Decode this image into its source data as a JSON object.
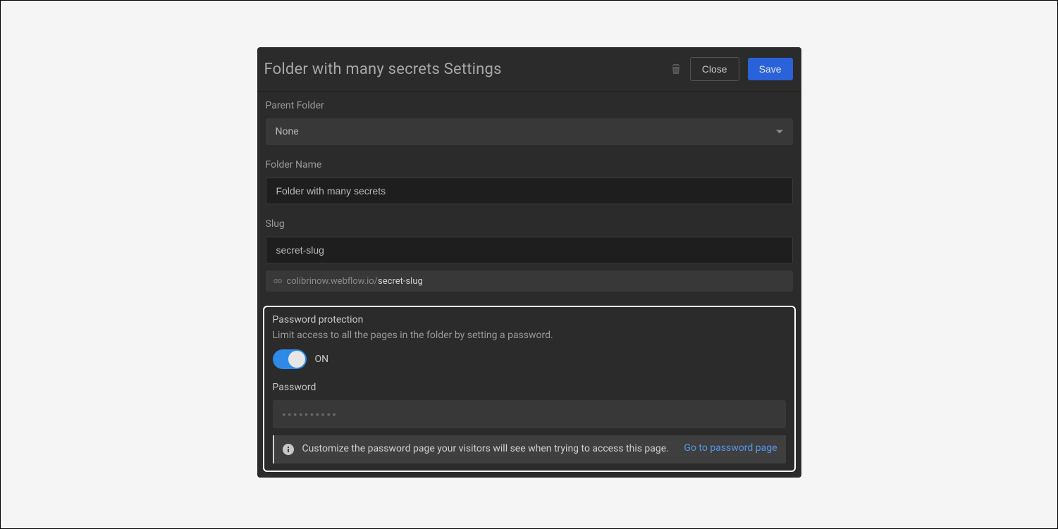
{
  "header": {
    "title": "Folder with many secrets Settings",
    "close_label": "Close",
    "save_label": "Save"
  },
  "form": {
    "parent_folder": {
      "label": "Parent Folder",
      "value": "None"
    },
    "folder_name": {
      "label": "Folder Name",
      "value": "Folder with many secrets"
    },
    "slug": {
      "label": "Slug",
      "value": "secret-slug",
      "url_domain": "colibrinow.webflow.io/",
      "url_slug": "secret-slug"
    }
  },
  "password": {
    "title": "Password protection",
    "description": "Limit access to all the pages in the folder by setting a password.",
    "toggle_state": "ON",
    "field_label": "Password",
    "placeholder": "••••••••••",
    "info_text": "Customize the password page your visitors will see when trying to access this page.",
    "info_link": "Go to password page"
  }
}
